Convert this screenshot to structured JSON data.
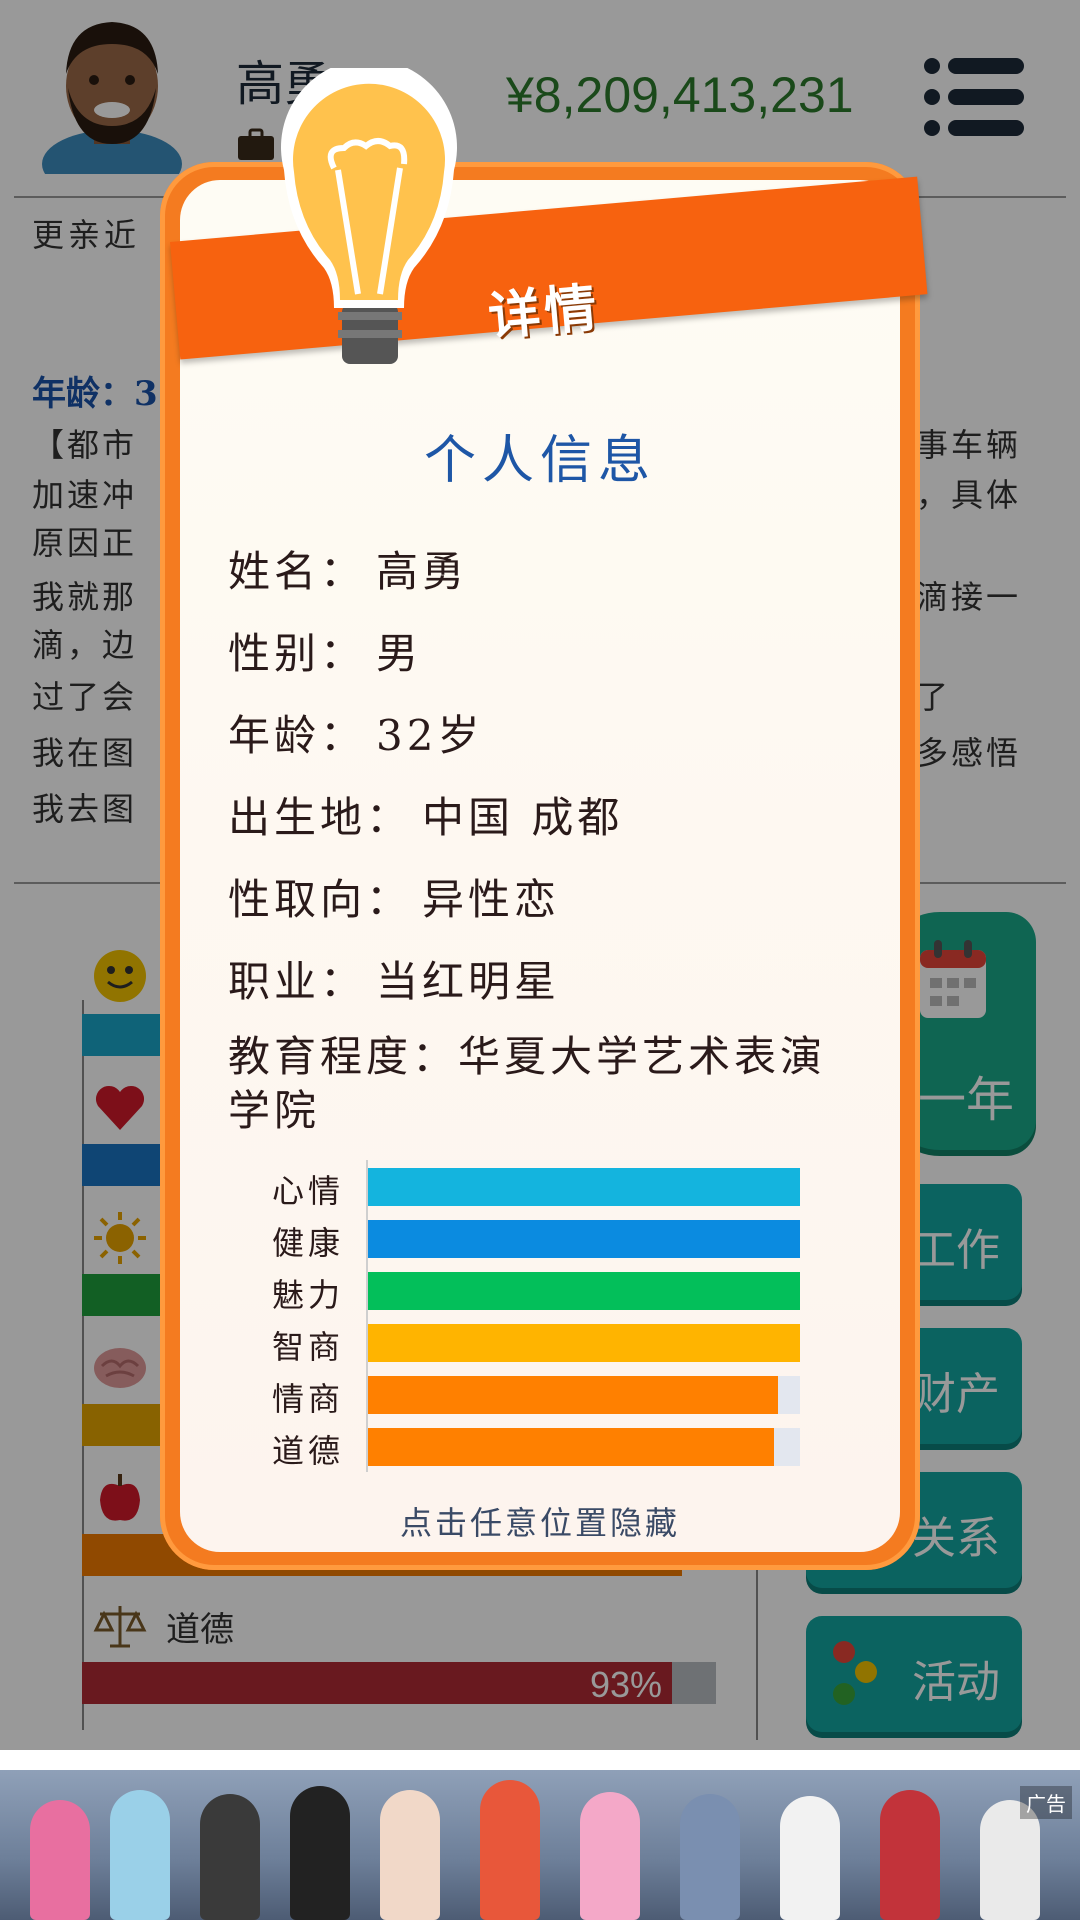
{
  "header": {
    "player_name": "高勇",
    "money": "¥8,209,413,231"
  },
  "story": {
    "intro": "更亲近",
    "age_line": "年龄：3",
    "lines": [
      {
        "left": "【都市",
        "right": "事车辆"
      },
      {
        "left": "加速冲",
        "right": "，具体"
      },
      {
        "left": "原因正",
        "right": ""
      },
      {
        "left": "我就那",
        "right": "滴接一"
      },
      {
        "left": "滴，边",
        "right": ""
      },
      {
        "left": "过了会",
        "right": "了"
      },
      {
        "left": "我在图",
        "right": "多感悟"
      },
      {
        "left": "我去图",
        "right": ""
      }
    ]
  },
  "stats_panel": {
    "moral_label": "道德",
    "moral_percent": "93%",
    "moral_value": 0.93,
    "bars": [
      {
        "name": "mood",
        "color": "#1aa6c9"
      },
      {
        "name": "health",
        "color": "#1a73c2"
      },
      {
        "name": "charm",
        "color": "#1f9e3c"
      },
      {
        "name": "iq",
        "color": "#e3a400"
      },
      {
        "name": "eq",
        "color": "#f07a00"
      }
    ]
  },
  "side_buttons": {
    "year": "一年",
    "work": "工作",
    "assets": "财产",
    "relations": "关系",
    "activity": "活动"
  },
  "ad": {
    "label": "广告"
  },
  "modal": {
    "banner": "详情",
    "title": "个人信息",
    "fields": {
      "name": {
        "label": "姓名：",
        "value": "高勇"
      },
      "gender": {
        "label": "性别：",
        "value": "男"
      },
      "age": {
        "label": "年龄：",
        "value": "32岁"
      },
      "birthplace": {
        "label": "出生地：",
        "value": "中国 成都"
      },
      "orientation": {
        "label": "性取向：",
        "value": "异性恋"
      },
      "job": {
        "label": "职业：",
        "value": "当红明星"
      },
      "education": {
        "label": "教育程度：",
        "value": "华夏大学艺术表演学院"
      }
    },
    "attributes": [
      {
        "label": "心情",
        "value": 1.0,
        "color": "#14b4de"
      },
      {
        "label": "健康",
        "value": 1.0,
        "color": "#0b8be0"
      },
      {
        "label": "魅力",
        "value": 1.0,
        "color": "#03bf5a"
      },
      {
        "label": "智商",
        "value": 1.0,
        "color": "#ffb400"
      },
      {
        "label": "情商",
        "value": 0.95,
        "color": "#ff8000"
      },
      {
        "label": "道德",
        "value": 0.94,
        "color": "#ff8000"
      }
    ],
    "hint": "点击任意位置隐藏"
  }
}
